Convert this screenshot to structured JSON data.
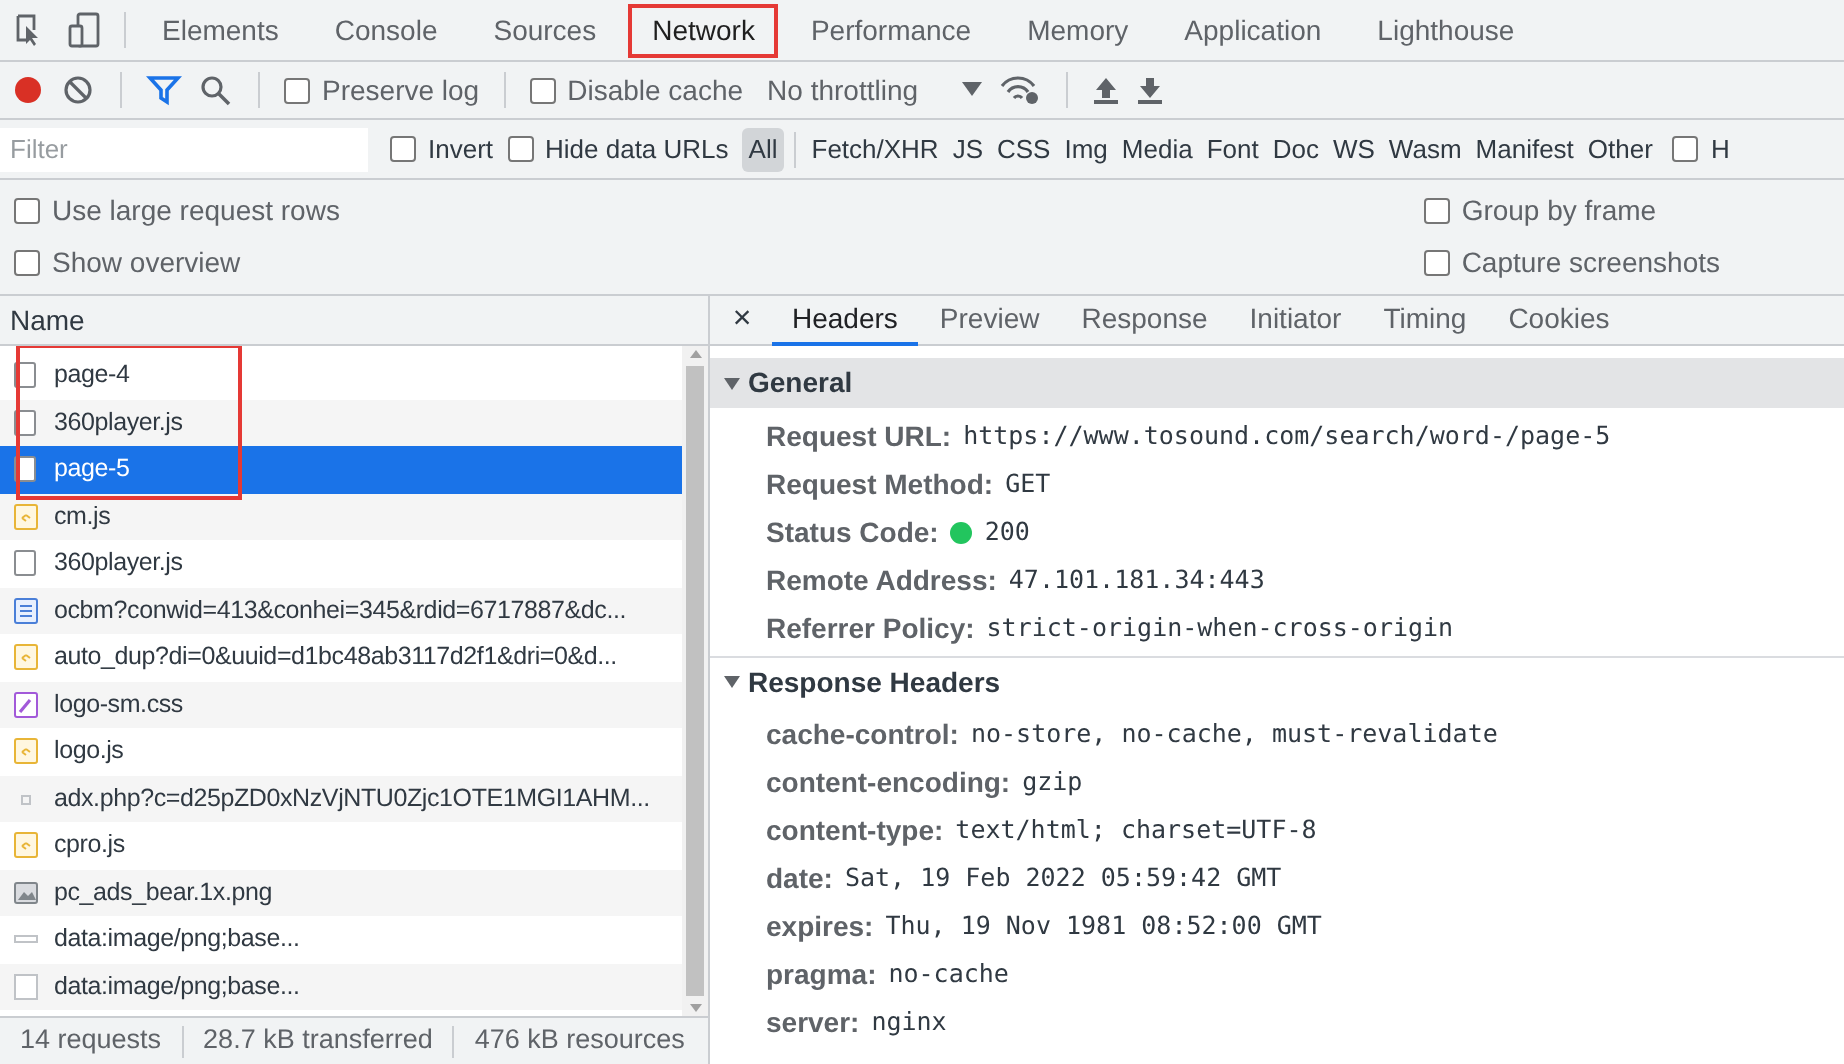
{
  "panel_tabs": [
    {
      "label": "Elements",
      "selected": false,
      "boxed": false
    },
    {
      "label": "Console",
      "selected": false,
      "boxed": false
    },
    {
      "label": "Sources",
      "selected": false,
      "boxed": false
    },
    {
      "label": "Network",
      "selected": true,
      "boxed": true
    },
    {
      "label": "Performance",
      "selected": false,
      "boxed": false
    },
    {
      "label": "Memory",
      "selected": false,
      "boxed": false
    },
    {
      "label": "Application",
      "selected": false,
      "boxed": false
    },
    {
      "label": "Lighthouse",
      "selected": false,
      "boxed": false
    }
  ],
  "toolbar": {
    "recording": true,
    "filter_active": true,
    "options": [
      {
        "label": "Preserve log",
        "checked": false
      },
      {
        "label": "Disable cache",
        "checked": false
      }
    ],
    "throttling": "No throttling"
  },
  "filter_bar": {
    "placeholder": "Filter",
    "options": [
      {
        "label": "Invert",
        "checked": false
      },
      {
        "label": "Hide data URLs",
        "checked": false
      }
    ],
    "types": [
      {
        "label": "All",
        "selected": true
      },
      {
        "label": "Fetch/XHR",
        "selected": false
      },
      {
        "label": "JS",
        "selected": false
      },
      {
        "label": "CSS",
        "selected": false
      },
      {
        "label": "Img",
        "selected": false
      },
      {
        "label": "Media",
        "selected": false
      },
      {
        "label": "Font",
        "selected": false
      },
      {
        "label": "Doc",
        "selected": false
      },
      {
        "label": "WS",
        "selected": false
      },
      {
        "label": "Wasm",
        "selected": false
      },
      {
        "label": "Manifest",
        "selected": false
      },
      {
        "label": "Other",
        "selected": false
      }
    ],
    "trailing_option": {
      "label": "H",
      "checked": false
    }
  },
  "settings": {
    "left": [
      {
        "label": "Use large request rows",
        "checked": false
      },
      {
        "label": "Show overview",
        "checked": false
      }
    ],
    "right": [
      {
        "label": "Group by frame",
        "checked": false
      },
      {
        "label": "Capture screenshots",
        "checked": false
      }
    ]
  },
  "requests": {
    "column": "Name",
    "rows": [
      {
        "name": "page-4",
        "kind": "doc",
        "selected": false,
        "boxed": true
      },
      {
        "name": "360player.js",
        "kind": "doc",
        "selected": false,
        "boxed": true
      },
      {
        "name": "page-5",
        "kind": "doc",
        "selected": true,
        "boxed": true
      },
      {
        "name": "cm.js",
        "kind": "script",
        "selected": false,
        "boxed": false
      },
      {
        "name": "360player.js",
        "kind": "doc",
        "selected": false,
        "boxed": false
      },
      {
        "name": "ocbm?conwid=413&conhei=345&rdid=6717887&dc...",
        "kind": "frame",
        "selected": false,
        "boxed": false
      },
      {
        "name": "auto_dup?di=0&uuid=d1bc48ab3117d2f1&dri=0&d...",
        "kind": "script",
        "selected": false,
        "boxed": false
      },
      {
        "name": "logo-sm.css",
        "kind": "style",
        "selected": false,
        "boxed": false
      },
      {
        "name": "logo.js",
        "kind": "script",
        "selected": false,
        "boxed": false
      },
      {
        "name": "adx.php?c=d25pZD0xNzVjNTU0Zjc1OTE1MGI1AHM...",
        "kind": "ping",
        "selected": false,
        "boxed": false
      },
      {
        "name": "cpro.js",
        "kind": "script",
        "selected": false,
        "boxed": false
      },
      {
        "name": "pc_ads_bear.1x.png",
        "kind": "image",
        "selected": false,
        "boxed": false
      },
      {
        "name": "data:image/png;base...",
        "kind": "data-strip",
        "selected": false,
        "boxed": false
      },
      {
        "name": "data:image/png;base...",
        "kind": "data-box",
        "selected": false,
        "boxed": false
      }
    ]
  },
  "summary": [
    "14 requests",
    "28.7 kB transferred",
    "476 kB resources"
  ],
  "details": {
    "close": "×",
    "tabs": [
      {
        "label": "Headers",
        "selected": true
      },
      {
        "label": "Preview",
        "selected": false
      },
      {
        "label": "Response",
        "selected": false
      },
      {
        "label": "Initiator",
        "selected": false
      },
      {
        "label": "Timing",
        "selected": false
      },
      {
        "label": "Cookies",
        "selected": false
      }
    ],
    "sections": [
      {
        "title": "General",
        "expanded": true,
        "shaded": true,
        "fields": [
          {
            "key": "Request URL:",
            "value": "https://www.tosound.com/search/word-/page-5"
          },
          {
            "key": "Request Method:",
            "value": "GET"
          },
          {
            "key": "Status Code:",
            "value": "200",
            "color": "#22c55e"
          },
          {
            "key": "Remote Address:",
            "value": "47.101.181.34:443"
          },
          {
            "key": "Referrer Policy:",
            "value": "strict-origin-when-cross-origin"
          }
        ]
      },
      {
        "title": "Response Headers",
        "expanded": true,
        "shaded": false,
        "fields": [
          {
            "key": "cache-control:",
            "value": "no-store, no-cache, must-revalidate"
          },
          {
            "key": "content-encoding:",
            "value": "gzip"
          },
          {
            "key": "content-type:",
            "value": "text/html; charset=UTF-8"
          },
          {
            "key": "date:",
            "value": "Sat, 19 Feb 2022 05:59:42 GMT"
          },
          {
            "key": "expires:",
            "value": "Thu, 19 Nov 1981 08:52:00 GMT"
          },
          {
            "key": "pragma:",
            "value": "no-cache"
          },
          {
            "key": "server:",
            "value": "nginx"
          }
        ]
      }
    ]
  }
}
